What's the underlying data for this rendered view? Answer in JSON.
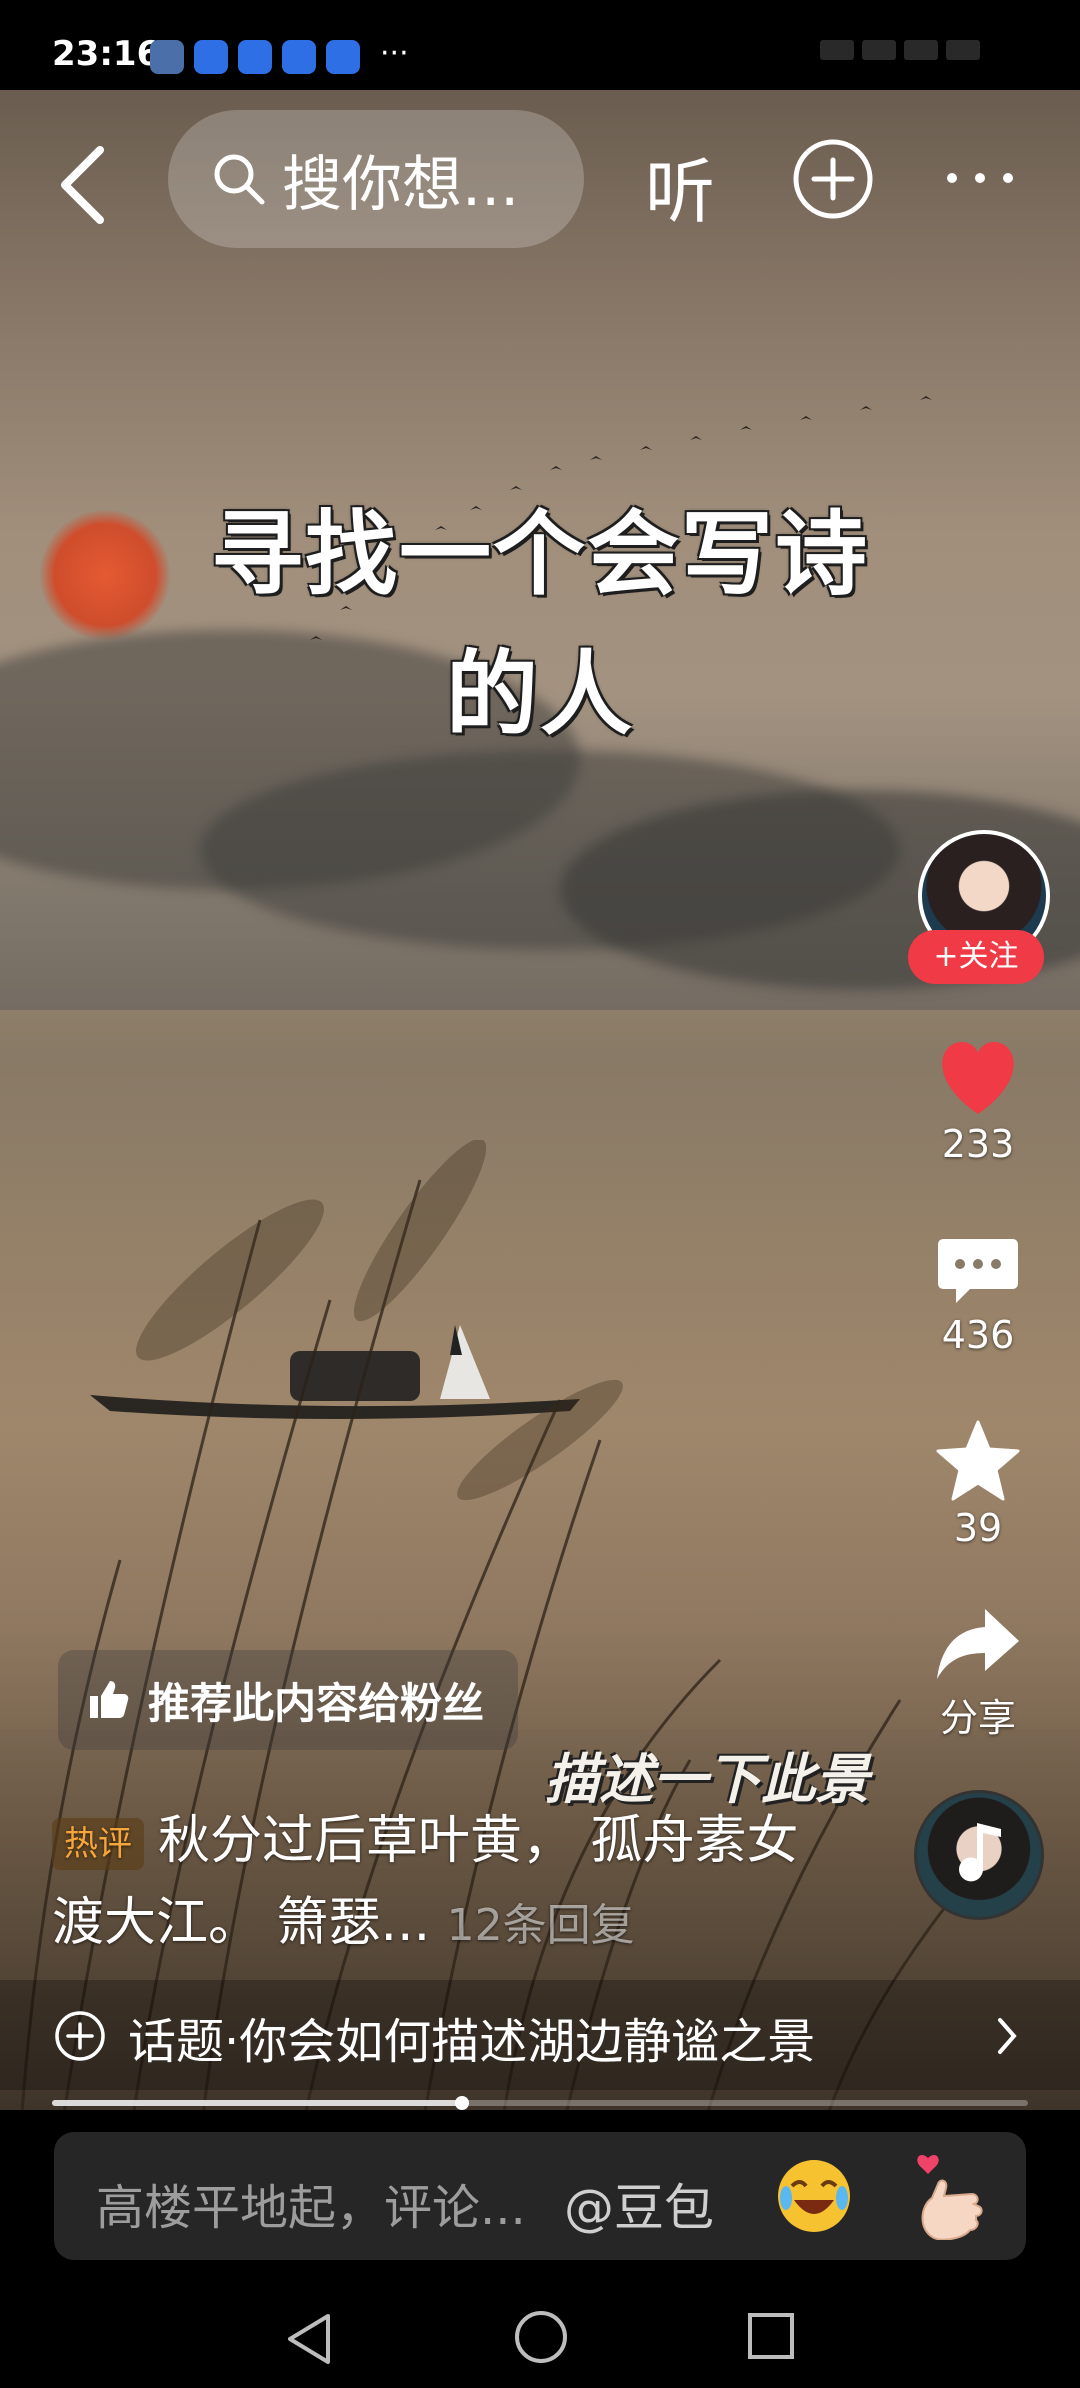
{
  "status_bar": {
    "time": "23:16",
    "more": "···"
  },
  "top_bar": {
    "search_placeholder": "搜你想...",
    "listen_label": "听"
  },
  "video": {
    "title_line1": "寻找一个会写诗",
    "title_line2": "的人",
    "overlay_caption": "描述一下此景"
  },
  "side_actions": {
    "follow_label": "+关注",
    "like_count": "233",
    "comment_count": "436",
    "favorite_count": "39",
    "share_label": "分享"
  },
  "recommend": {
    "label": "推荐此内容给粉丝"
  },
  "hot_comment": {
    "tag": "热评",
    "text": "秋分过后草叶黄， 孤舟素女渡大江。 箫瑟...",
    "reply_count": "12条回复"
  },
  "topic": {
    "label": "话题·你会如何描述湖边静谧之景"
  },
  "playback": {
    "progress": 0.42
  },
  "comment_bar": {
    "placeholder": "高楼平地起，评论...",
    "mention": "@豆包"
  },
  "colors": {
    "like": "#f03a46",
    "hot_tag": "#f5a53a",
    "follow": "#f03a46"
  }
}
